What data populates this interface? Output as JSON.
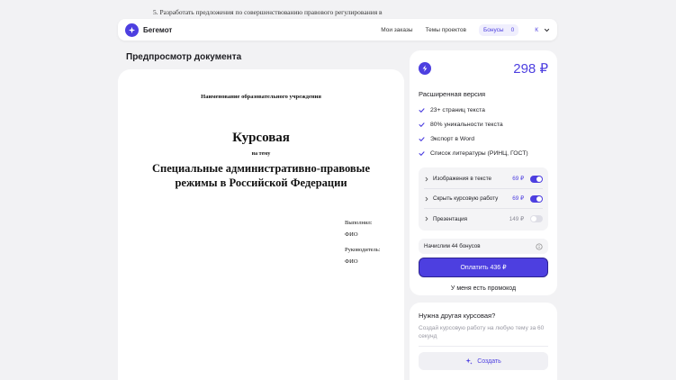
{
  "background": {
    "line1": "5. Разработать предложения по совершенствованию правового регулирования в",
    "line2": "... ..."
  },
  "header": {
    "logo_text": "Бегемот",
    "nav": [
      "Мои заказы",
      "Темы проектов"
    ],
    "bonus_label": "Бонусы",
    "bonus_count": "0",
    "user_initial": "К"
  },
  "preview": {
    "title": "Предпросмотр документа"
  },
  "document": {
    "institution": "Наименование образовательного учреждения",
    "type": "Курсовая",
    "on_topic": "на тему",
    "topic": "Специальные административно-правовые режимы в Российской Федерации",
    "performed_label": "Выполнил:",
    "performed_value": "ФИО",
    "supervisor_label": "Руководитель:",
    "supervisor_value": "ФИО"
  },
  "pricing": {
    "price": "298 ₽",
    "version": "Расширенная версия",
    "features": [
      "23+ страниц текста",
      "80% уникальности текста",
      "Экспорт в Word",
      "Список литературы (РИНЦ, ГОСТ)"
    ],
    "options": [
      {
        "name": "Изображения в тексте",
        "price": "69 ₽",
        "enabled": true
      },
      {
        "name": "Скрыть курсовую работу",
        "price": "69 ₽",
        "enabled": true
      },
      {
        "name": "Презентация",
        "price": "149 ₽",
        "enabled": false
      }
    ],
    "accrue_text": "Начислим 44 бонусов",
    "pay_button": "Оплатить  436 ₽",
    "promo_link": "У меня есть промокод"
  },
  "other": {
    "title": "Нужна другая курсовая?",
    "description": "Создай курсовую работу на любую тему за 60 секунд",
    "create_button": "Создать"
  },
  "colors": {
    "accent": "#4d3fe0",
    "background": "#f2f2f4"
  }
}
